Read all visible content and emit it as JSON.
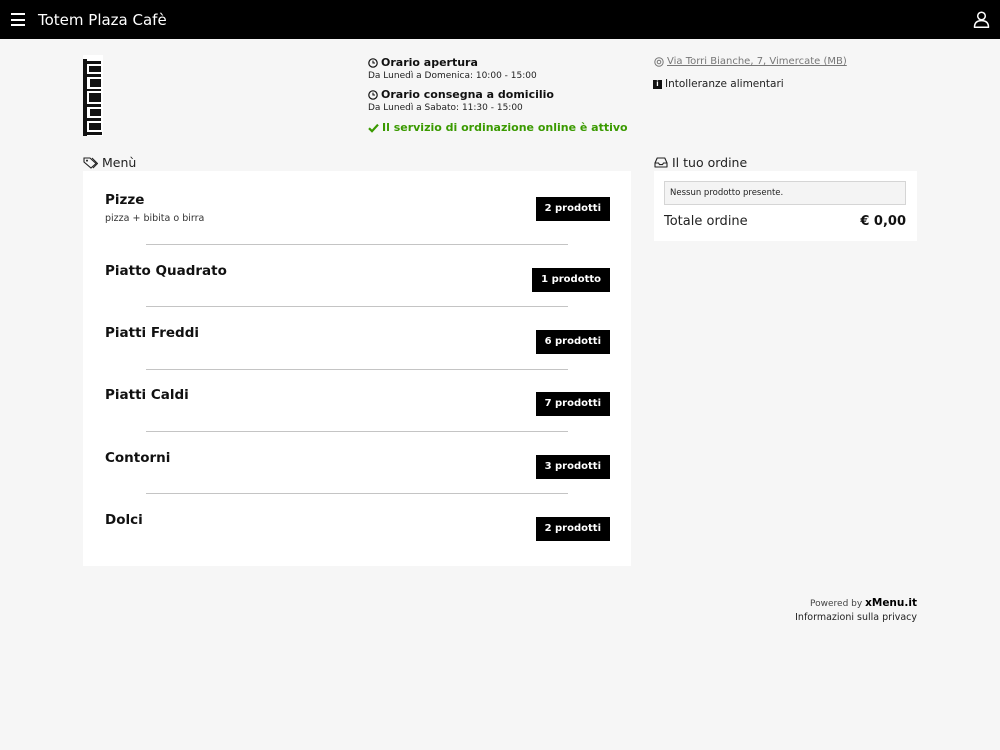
{
  "header": {
    "title": "Totem Plaza Cafè",
    "menu_icon": "hamburger-icon",
    "user_icon": "user-icon"
  },
  "info": {
    "opening_title": "Orario apertura",
    "opening_hours": "Da Lunedì a Domenica: 10:00 - 15:00",
    "delivery_title": "Orario consegna a domicilio",
    "delivery_hours": "Da Lunedì a Sabato: 11:30 - 15:00",
    "online_status": "Il servizio di ordinazione online è attivo",
    "address": "Via Torri Bianche, 7, Vimercate (MB)",
    "allergens": "Intolleranze alimentari"
  },
  "menu": {
    "heading": "Menù",
    "categories": [
      {
        "name": "Pizze",
        "description": "pizza + bibita o birra",
        "count": "2 prodotti"
      },
      {
        "name": "Piatto Quadrato",
        "count": "1 prodotto"
      },
      {
        "name": "Piatti Freddi",
        "count": "6 prodotti"
      },
      {
        "name": "Piatti Caldi",
        "count": "7 prodotti"
      },
      {
        "name": "Contorni",
        "count": "3 prodotti"
      },
      {
        "name": "Dolci",
        "count": "2 prodotti"
      }
    ]
  },
  "order": {
    "heading": "Il tuo ordine",
    "empty_text": "Nessun prodotto presente.",
    "total_label": "Totale ordine",
    "total_value": "€ 0,00"
  },
  "footer": {
    "powered_by": "Powered by",
    "brand": "xMenu.it",
    "privacy": "Informazioni sulla privacy"
  },
  "colors": {
    "topbar": "#000000",
    "online_green": "#3a9a00",
    "badge": "#000000"
  }
}
